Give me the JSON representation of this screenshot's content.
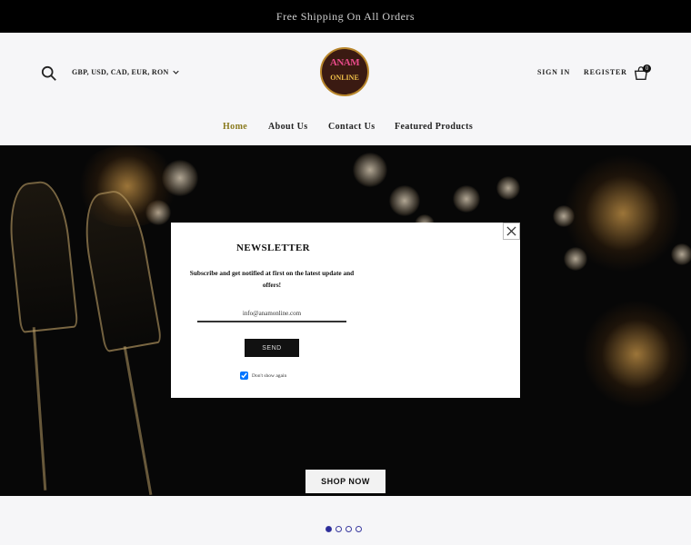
{
  "announcement": "Free Shipping On All Orders",
  "header": {
    "currency_label": "GBP, USD, CAD, EUR, RON",
    "logo_text_top": "ANAM",
    "logo_text_bottom": "ONLINE",
    "signin_label": "SIGN IN",
    "register_label": "REGISTER",
    "cart_count": "0"
  },
  "nav": {
    "items": [
      {
        "label": "Home",
        "active": true
      },
      {
        "label": "About Us",
        "active": false
      },
      {
        "label": "Contact Us",
        "active": false
      },
      {
        "label": "Featured Products",
        "active": false
      }
    ]
  },
  "hero": {
    "cta_label": "SHOP NOW",
    "slides": 4,
    "active_slide": 1
  },
  "newsletter": {
    "title": "NEWSLETTER",
    "description": "Subscribe and get notified at first on the latest update and offers!",
    "email_placeholder": "info@anamonline.com",
    "send_label": "SEND",
    "dont_show_label": "Don't show again",
    "dont_show_checked": true
  },
  "colors": {
    "nav_active": "#8a7a1e",
    "topbar_bg": "#000000",
    "dot_active": "#2b2b9a"
  }
}
